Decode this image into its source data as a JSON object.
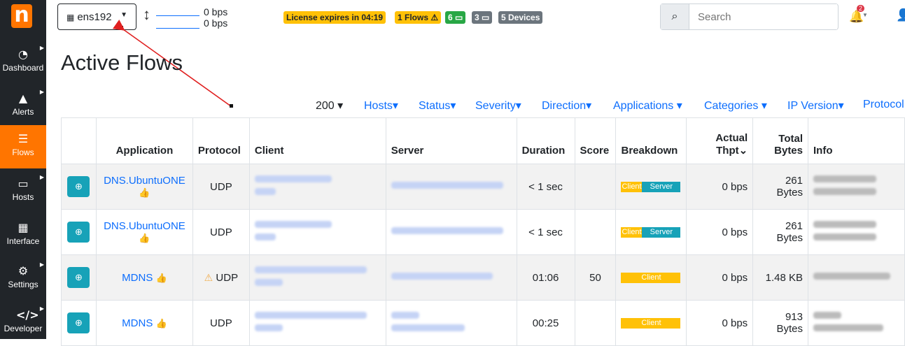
{
  "sidebar": {
    "logo": "n",
    "items": [
      {
        "label": "Dashboard",
        "icon": "gauge-icon",
        "glyph": "◔"
      },
      {
        "label": "Alerts",
        "icon": "warning-icon",
        "glyph": "▲"
      },
      {
        "label": "Flows",
        "icon": "flows-icon",
        "glyph": "☰"
      },
      {
        "label": "Hosts",
        "icon": "laptop-icon",
        "glyph": "▭"
      },
      {
        "label": "Interface",
        "icon": "ethernet-icon",
        "glyph": "▦"
      },
      {
        "label": "Settings",
        "icon": "gear-icon",
        "glyph": "⚙"
      },
      {
        "label": "Developer",
        "icon": "code-icon",
        "glyph": "</>"
      }
    ]
  },
  "topbar": {
    "interface": "ens192",
    "upload": "0 bps",
    "download": "0 bps",
    "license": "License expires in 04:19",
    "flows_badge": "1 Flows ⚠",
    "b6": "6 ▭",
    "b3": "3 ▭",
    "devices": "5 Devices",
    "search_placeholder": "Search",
    "notif_count": "2"
  },
  "colors": {
    "accent": "#ff7500",
    "link": "#0d6efd",
    "warning": "#ffc107",
    "success": "#28a745",
    "secondary": "#6c757d",
    "info": "#17a2b8"
  },
  "page_title": "Active Flows",
  "filters": {
    "rows": "200",
    "hosts": "Hosts",
    "status": "Status",
    "severity": "Severity",
    "direction": "Direction",
    "applications": "Applications",
    "categories": "Categories",
    "ip_version": "IP Version",
    "protocol": "Protocol"
  },
  "table": {
    "headers": {
      "application": "Application",
      "protocol": "Protocol",
      "client": "Client",
      "server": "Server",
      "duration": "Duration",
      "score": "Score",
      "breakdown": "Breakdown",
      "thpt1": "Actual",
      "thpt2": "Thpt",
      "bytes1": "Total",
      "bytes2": "Bytes",
      "info": "Info"
    },
    "rows": [
      {
        "app": "DNS.UbuntuONE",
        "protocol": "UDP",
        "duration": "< 1 sec",
        "score": "",
        "client_label": "Client",
        "server_label": "Server",
        "thpt": "0 bps",
        "bytes1": "261",
        "bytes2": "Bytes",
        "client_share": 0.35
      },
      {
        "app": "DNS.UbuntuONE",
        "protocol": "UDP",
        "duration": "< 1 sec",
        "score": "",
        "client_label": "Client",
        "server_label": "Server",
        "thpt": "0 bps",
        "bytes1": "261",
        "bytes2": "Bytes",
        "client_share": 0.35
      },
      {
        "app": "MDNS",
        "protocol": "UDP",
        "duration": "01:06",
        "score": "50",
        "client_label": "Client",
        "server_label": "",
        "thpt": "0 bps",
        "bytes1": "1.48 KB",
        "bytes2": "",
        "client_share": 1.0
      },
      {
        "app": "MDNS",
        "protocol": "UDP",
        "duration": "00:25",
        "score": "",
        "client_label": "Client",
        "server_label": "",
        "thpt": "0 bps",
        "bytes1": "913",
        "bytes2": "Bytes",
        "client_share": 1.0
      }
    ]
  }
}
